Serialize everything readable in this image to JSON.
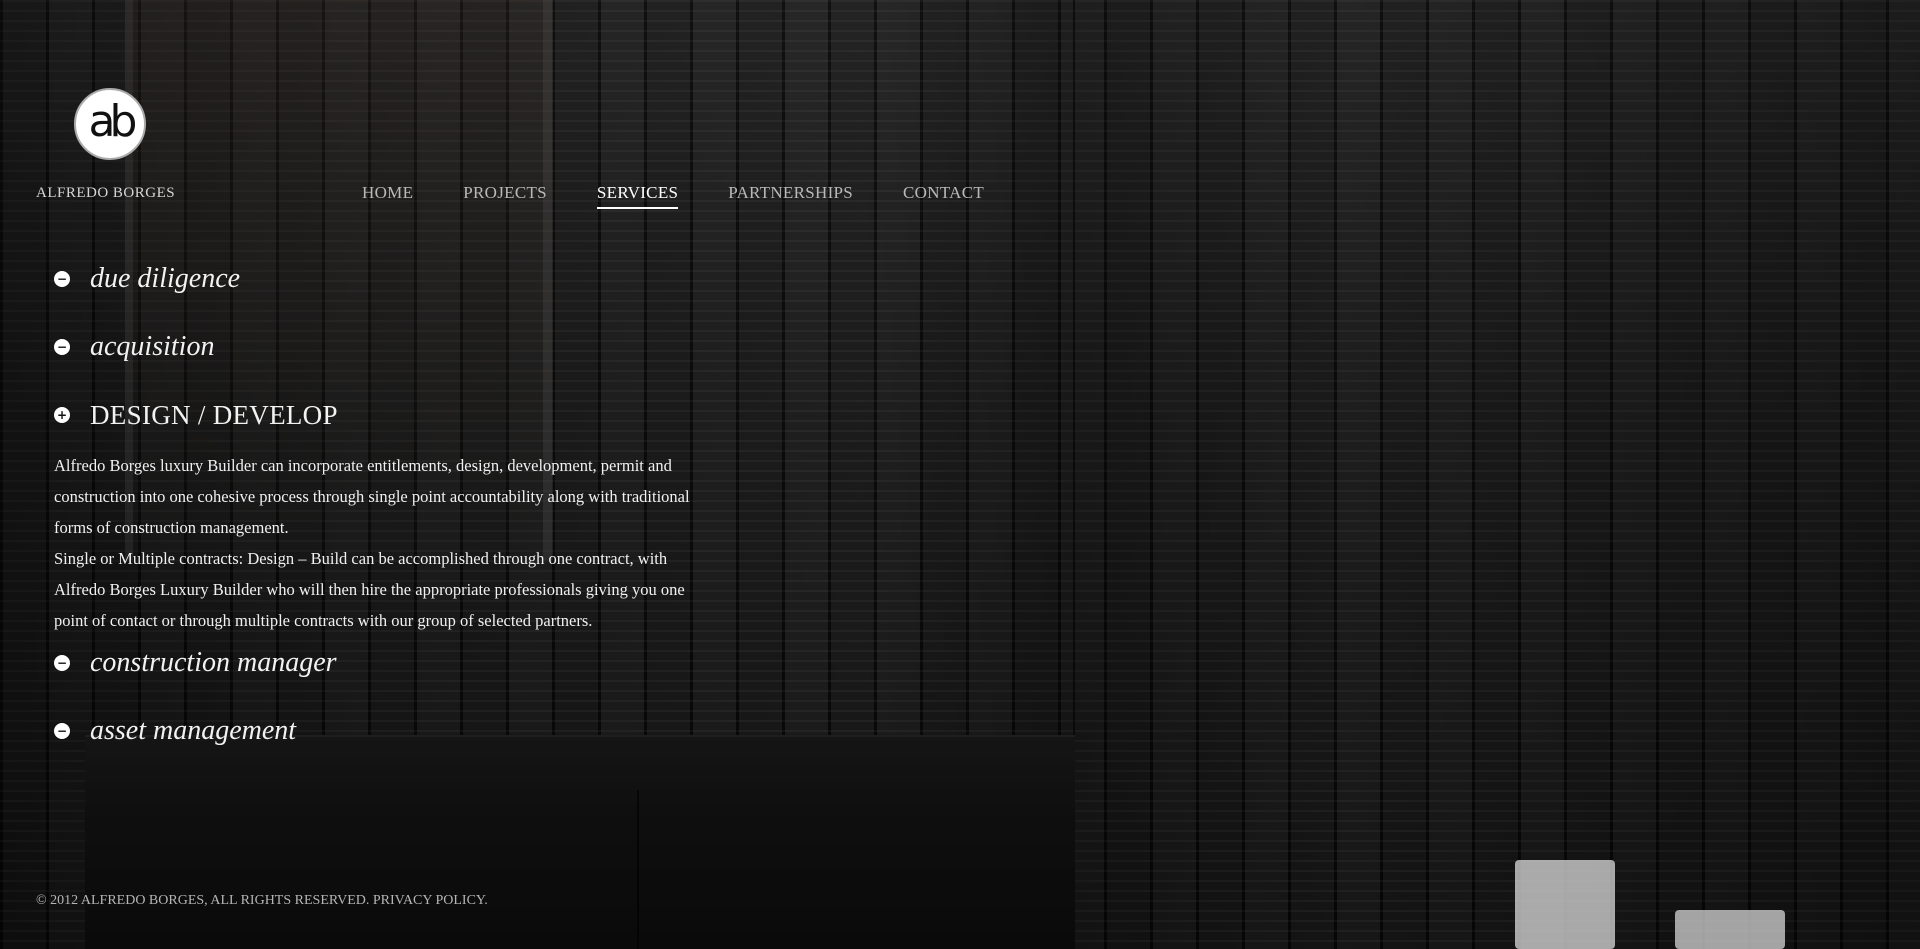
{
  "brand": {
    "logo_mark": "ab",
    "name": "ALFREDO BORGES"
  },
  "nav": {
    "items": [
      {
        "label": "HOME"
      },
      {
        "label": "PROJECTS"
      },
      {
        "label": "SERVICES",
        "active": true
      },
      {
        "label": "PARTNERSHIPS"
      },
      {
        "label": "CONTACT"
      }
    ]
  },
  "services": [
    {
      "title": "due diligence",
      "expanded": false,
      "toggle_icon": "minus-circle-icon",
      "toggle_symbol": "−"
    },
    {
      "title": "acquisition",
      "expanded": false,
      "toggle_icon": "minus-circle-icon",
      "toggle_symbol": "−"
    },
    {
      "title": "DESIGN / DEVELOP",
      "expanded": true,
      "toggle_icon": "plus-circle-icon",
      "toggle_symbol": "+",
      "body": [
        "Alfredo Borges luxury Builder can incorporate entitlements, design, development, permit and construction into one cohesive process through single point accountability along with traditional forms of construction management.",
        "Single or Multiple contracts: Design – Build can be accomplished through one contract, with Alfredo Borges Luxury Builder who will then hire the appropriate professionals giving you one point of contact or through multiple contracts with our group of selected partners."
      ]
    },
    {
      "title": "construction manager",
      "expanded": false,
      "toggle_icon": "minus-circle-icon",
      "toggle_symbol": "−"
    },
    {
      "title": "asset management",
      "expanded": false,
      "toggle_icon": "minus-circle-icon",
      "toggle_symbol": "−"
    }
  ],
  "footer": {
    "text": "© 2012 ALFREDO BORGES, ALL RIGHTS RESERVED. PRIVACY POLICY."
  },
  "colors": {
    "background": "#0b0b0b",
    "text": "#f2f2f2",
    "nav_inactive": "#b9b9b9",
    "nav_active": "#ffffff"
  }
}
